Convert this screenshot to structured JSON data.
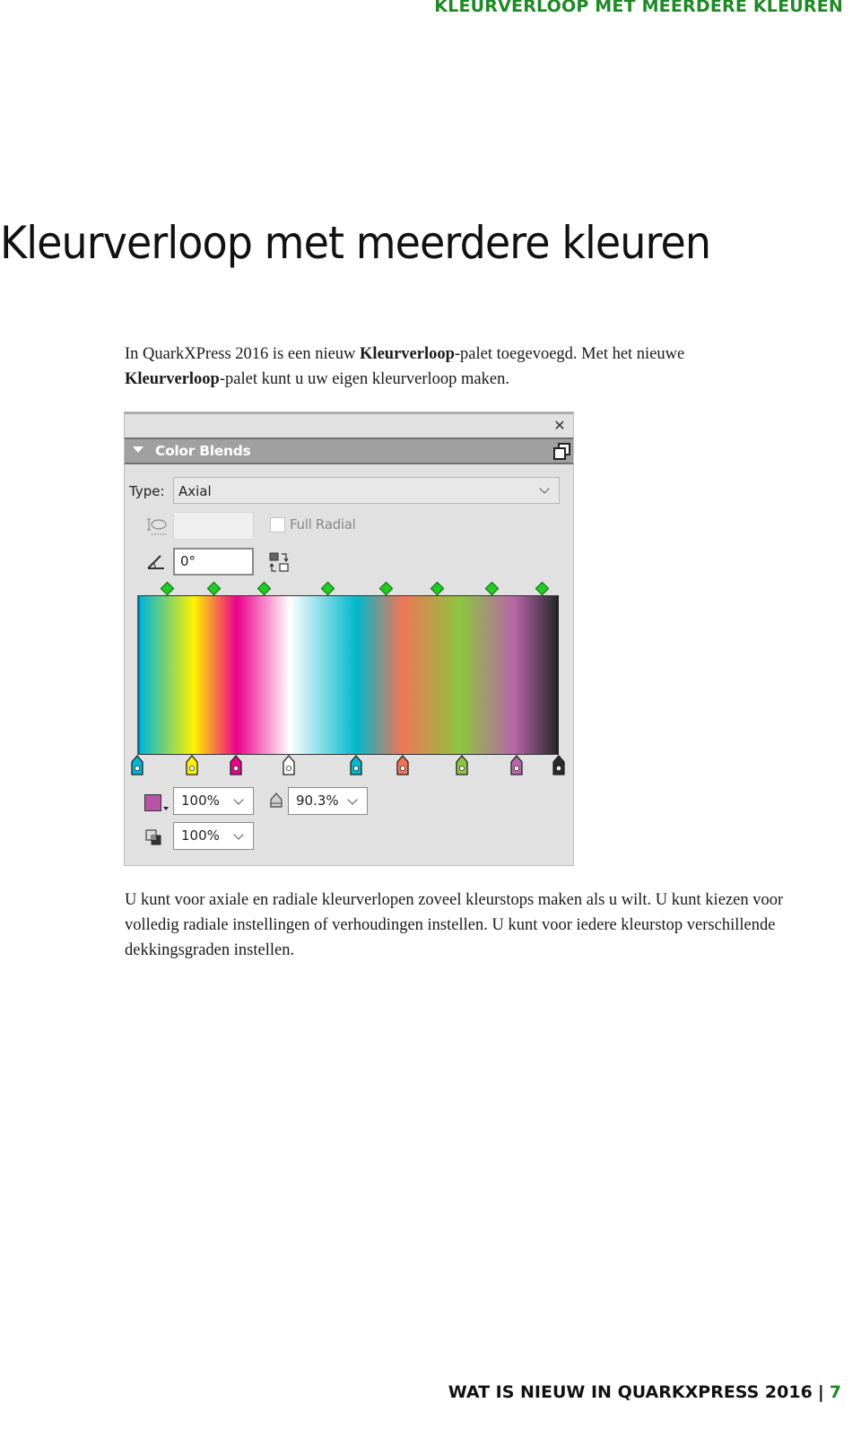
{
  "running_head": "KLEURVERLOOP MET MEERDERE KLEUREN",
  "title": "Kleurverloop met meerdere kleuren",
  "intro": {
    "part1": "In QuarkXPress 2016 is een nieuw ",
    "bold1": "Kleurverloop",
    "part2": "-palet toegevoegd. Met het nieuwe ",
    "bold2": "Kleurverloop",
    "part3": "-palet kunt u uw eigen kleurverloop maken."
  },
  "panel": {
    "title": "Color Blends",
    "close_icon": "close-x-icon",
    "undock_icon": "undock-icon",
    "type_label": "Type:",
    "type_value": "Axial",
    "aspect_value": "",
    "full_radial_label": "Full Radial",
    "full_radial_checked": false,
    "angle_value": "0°",
    "opacity_stops": [
      0.07,
      0.18,
      0.3,
      0.45,
      0.59,
      0.71,
      0.84,
      0.96
    ],
    "color_stops": [
      {
        "pos": 0.0,
        "color": "#00b4d8"
      },
      {
        "pos": 0.13,
        "color": "#fff200"
      },
      {
        "pos": 0.233,
        "color": "#ec008c"
      },
      {
        "pos": 0.36,
        "color": "#ffffff"
      },
      {
        "pos": 0.52,
        "color": "#00b8cc"
      },
      {
        "pos": 0.63,
        "color": "#f07557"
      },
      {
        "pos": 0.77,
        "color": "#8dc63f"
      },
      {
        "pos": 0.9,
        "color": "#b864a8"
      },
      {
        "pos": 1.0,
        "color": "#2a2a2e"
      }
    ],
    "selected_color": "#b853a6",
    "shade_value": "100%",
    "opacity_value": "90.3%",
    "blend_value": "100%"
  },
  "body": "U kunt voor axiale en radiale kleurverlopen zoveel kleurstops maken als u wilt. U kunt kiezen voor volledig radiale instellingen of verhoudingen instellen. U kunt voor iedere kleurstop verschillende dekkingsgraden instellen.",
  "footer": {
    "text": "WAT IS NIEUW IN QUARKXPRESS 2016",
    "separator": "|",
    "page": "7"
  }
}
